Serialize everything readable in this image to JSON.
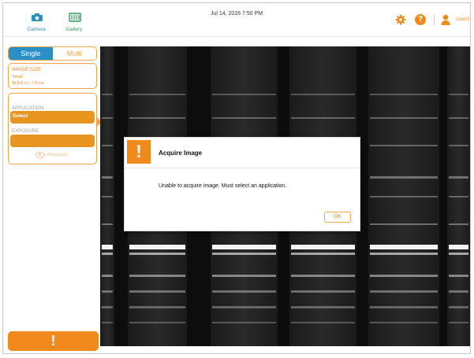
{
  "header": {
    "nav": [
      {
        "label": "Camera"
      },
      {
        "label": "Gallery"
      }
    ],
    "datetime": "Jul 14, 2016  7:50 PM",
    "user": "User2",
    "icons": {
      "settings": "gear-icon",
      "help": "help-icon",
      "user": "user-icon"
    },
    "accent_color": "#f08a1c"
  },
  "sidebar": {
    "mode_tabs": [
      {
        "label": "Single",
        "active": true
      },
      {
        "label": "Multi",
        "active": false
      }
    ],
    "image_size": {
      "title": "IMAGE SIZE",
      "line1": "Small",
      "line2": "W 8.8 x L 7.8 cm"
    },
    "application": {
      "label": "APPLICATION",
      "value": "Select"
    },
    "exposure": {
      "label": "EXPOSURE",
      "value": ""
    },
    "preview_label": "Preview",
    "acquire_label": "!"
  },
  "dialog": {
    "icon": "!",
    "title": "Acquire Image",
    "message": "Unable to acquire image. Must select an application.",
    "ok_label": "OK"
  }
}
